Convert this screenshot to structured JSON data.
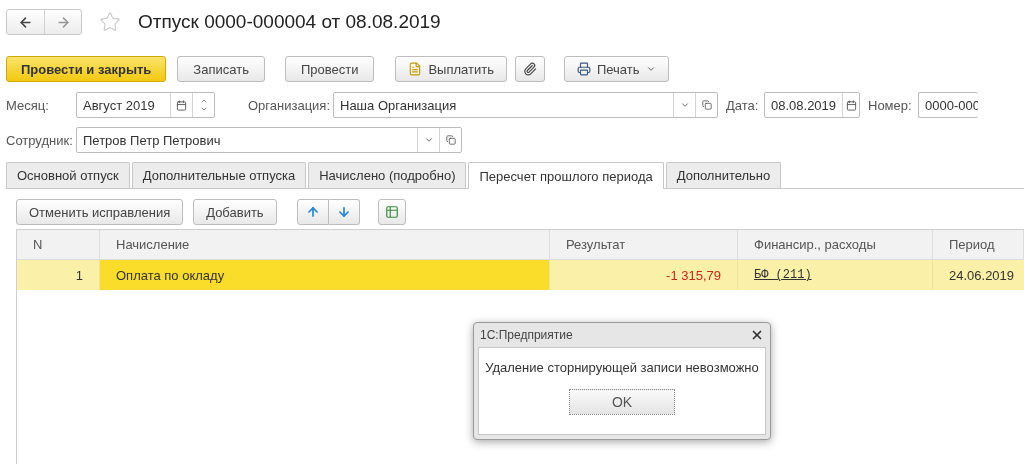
{
  "header": {
    "favorite": false,
    "title": "Отпуск 0000-000004 от 08.08.2019"
  },
  "toolbar": [
    {
      "kind": "primary",
      "label": "Провести и закрыть"
    },
    {
      "kind": "plain",
      "label": "Записать"
    },
    {
      "kind": "plain",
      "label": "Провести"
    },
    {
      "kind": "pay",
      "label": "Выплатить"
    },
    {
      "kind": "attach"
    },
    {
      "kind": "print",
      "label": "Печать"
    }
  ],
  "field_rows": [
    [
      {
        "kind": "period",
        "label": "Месяц:",
        "value": "Август 2019"
      },
      {
        "kind": "reference",
        "label": "Организация:",
        "value": "Наша Организация"
      },
      {
        "kind": "date",
        "label": "Дата:",
        "value": "08.08.2019"
      },
      {
        "kind": "text",
        "label": "Номер:",
        "value": "0000-000"
      }
    ],
    [
      {
        "kind": "reference",
        "label": "Сотрудник:",
        "value": "Петров Петр Петрович"
      }
    ]
  ],
  "tabs": [
    {
      "label": "Основной отпуск",
      "selected": false
    },
    {
      "label": "Дополнительные отпуска",
      "selected": false
    },
    {
      "label": "Начислено (подробно)",
      "selected": false
    },
    {
      "label": "Пересчет прошлого периода",
      "selected": true
    },
    {
      "label": "Дополнительно",
      "selected": false
    }
  ],
  "table_toolbar": [
    {
      "kind": "text",
      "label": "Отменить исправления"
    },
    {
      "kind": "text",
      "label": "Добавить"
    },
    {
      "kind": "move"
    },
    {
      "kind": "add_table"
    }
  ],
  "table": {
    "columns": [
      "N",
      "Начисление",
      "Результат",
      "Финансир., расходы",
      "Период"
    ],
    "rows": [
      {
        "selected": true,
        "cells": [
          {
            "kind": "number",
            "text": "1",
            "focused": false
          },
          {
            "kind": "text",
            "text": "Оплата по окладу",
            "focused": true
          },
          {
            "kind": "amount",
            "text": "-1 315,79",
            "focused": false
          },
          {
            "kind": "link",
            "text": "БФ (211)",
            "focused": false
          },
          {
            "kind": "text",
            "text": "24.06.2019",
            "focused": false
          }
        ]
      }
    ]
  },
  "dialog": {
    "title": "1С:Предприятие",
    "message": "Удаление сторнирующей записи невозможно",
    "button": "OK"
  }
}
